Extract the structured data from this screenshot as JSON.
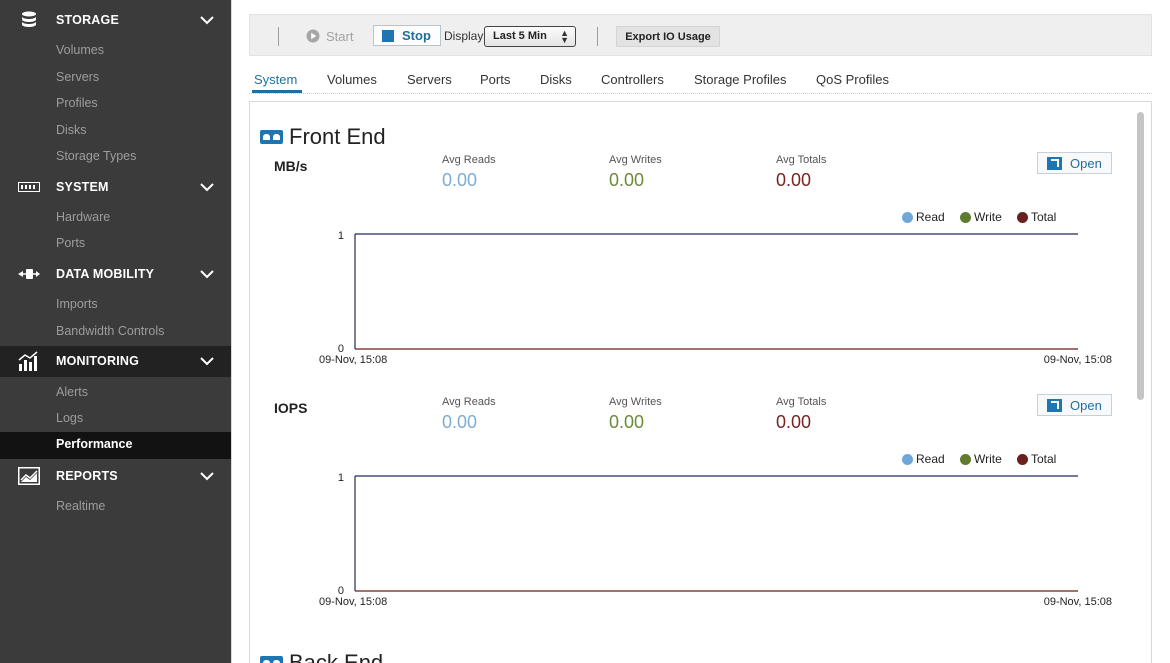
{
  "sidebar": {
    "sections": [
      {
        "label": "STORAGE",
        "icon": "database-icon",
        "items": [
          "Volumes",
          "Servers",
          "Profiles",
          "Disks",
          "Storage Types"
        ]
      },
      {
        "label": "SYSTEM",
        "icon": "server-rack-icon",
        "items": [
          "Hardware",
          "Ports"
        ]
      },
      {
        "label": "DATA MOBILITY",
        "icon": "data-transfer-icon",
        "items": [
          "Imports",
          "Bandwidth Controls"
        ]
      },
      {
        "label": "MONITORING",
        "icon": "bar-chart-icon",
        "items": [
          "Alerts",
          "Logs",
          "Performance"
        ]
      },
      {
        "label": "REPORTS",
        "icon": "line-chart-icon",
        "items": [
          "Realtime"
        ]
      }
    ],
    "active_section": "MONITORING",
    "active_item": "Performance"
  },
  "toolbar": {
    "start_label": "Start",
    "stop_label": "Stop",
    "display_label": "Display",
    "display_selected": "Last 5 Min",
    "export_label": "Export IO Usage"
  },
  "tabs": [
    "System",
    "Volumes",
    "Servers",
    "Ports",
    "Disks",
    "Controllers",
    "Storage Profiles",
    "QoS Profiles"
  ],
  "active_tab": "System",
  "front_end": {
    "title": "Front End",
    "open_label": "Open",
    "stat_labels": [
      "Avg Reads",
      "Avg Writes",
      "Avg Totals"
    ],
    "legend": [
      "Read",
      "Write",
      "Total"
    ],
    "metrics": [
      {
        "name": "MB/s",
        "avg_reads": "0.00",
        "avg_writes": "0.00",
        "avg_totals": "0.00",
        "y_max": "1",
        "y_min": "0",
        "x_start": "09-Nov, 15:08",
        "x_end": "09-Nov, 15:08"
      },
      {
        "name": "IOPS",
        "avg_reads": "0.00",
        "avg_writes": "0.00",
        "avg_totals": "0.00",
        "y_max": "1",
        "y_min": "0",
        "x_start": "09-Nov, 15:08",
        "x_end": "09-Nov, 15:08"
      }
    ]
  },
  "next_section_title": "Back End",
  "colors": {
    "accent": "#1f6fa3",
    "read": "#6fa8d6",
    "write": "#5f7b2e",
    "total": "#6b1f1f",
    "read_value": "#7aaed6",
    "write_value": "#6b8a3a",
    "total_value": "#7a2222",
    "chart_frame": "#23275f"
  },
  "chart_data": [
    {
      "type": "line",
      "title": "MB/s",
      "series": [
        {
          "name": "Read",
          "values": [
            0
          ]
        },
        {
          "name": "Write",
          "values": [
            0
          ]
        },
        {
          "name": "Total",
          "values": [
            0
          ]
        }
      ],
      "x": [
        "09-Nov, 15:08"
      ],
      "ylim": [
        0,
        1
      ]
    },
    {
      "type": "line",
      "title": "IOPS",
      "series": [
        {
          "name": "Read",
          "values": [
            0
          ]
        },
        {
          "name": "Write",
          "values": [
            0
          ]
        },
        {
          "name": "Total",
          "values": [
            0
          ]
        }
      ],
      "x": [
        "09-Nov, 15:08"
      ],
      "ylim": [
        0,
        1
      ]
    }
  ]
}
